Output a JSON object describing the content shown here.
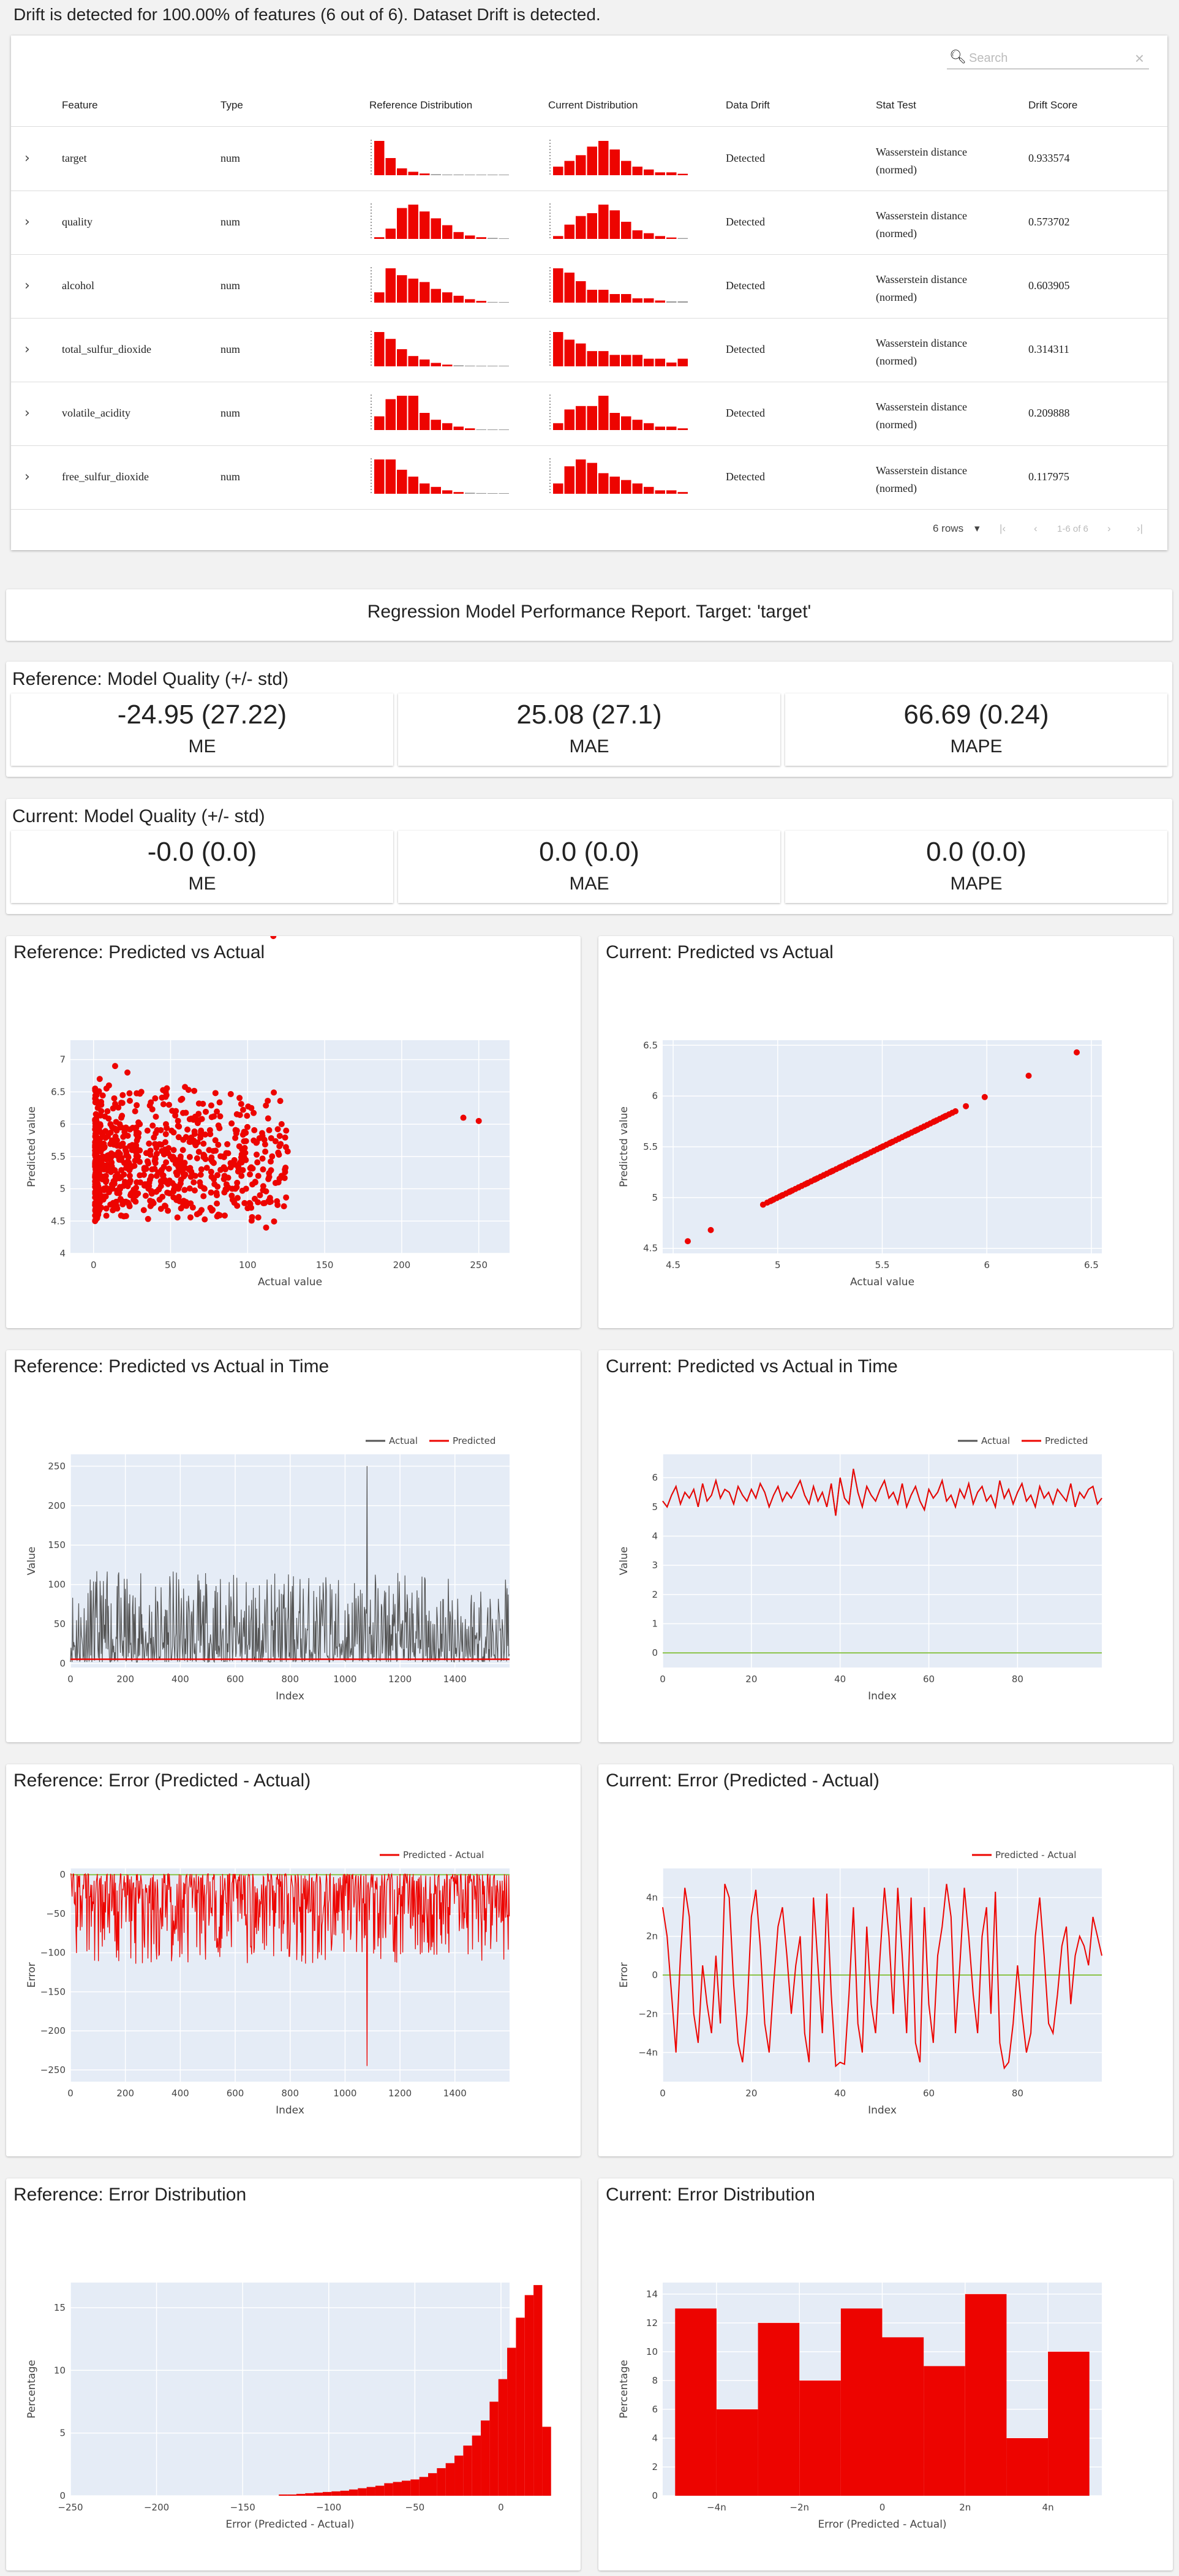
{
  "drift": {
    "header": "Drift is detected for 100.00% of features (6 out of 6). Dataset Drift is detected.",
    "search_placeholder": "Search",
    "columns": [
      "Feature",
      "Type",
      "Reference Distribution",
      "Current Distribution",
      "Data Drift",
      "Stat Test",
      "Drift Score"
    ],
    "rows": [
      {
        "feature": "target",
        "type": "num",
        "drift": "Detected",
        "stat_test": "Wasserstein distance (normed)",
        "score": "0.933574"
      },
      {
        "feature": "quality",
        "type": "num",
        "drift": "Detected",
        "stat_test": "Wasserstein distance (normed)",
        "score": "0.573702"
      },
      {
        "feature": "alcohol",
        "type": "num",
        "drift": "Detected",
        "stat_test": "Wasserstein distance (normed)",
        "score": "0.603905"
      },
      {
        "feature": "total_sulfur_dioxide",
        "type": "num",
        "drift": "Detected",
        "stat_test": "Wasserstein distance (normed)",
        "score": "0.314311"
      },
      {
        "feature": "volatile_acidity",
        "type": "num",
        "drift": "Detected",
        "stat_test": "Wasserstein distance (normed)",
        "score": "0.209888"
      },
      {
        "feature": "free_sulfur_dioxide",
        "type": "num",
        "drift": "Detected",
        "stat_test": "Wasserstein distance (normed)",
        "score": "0.117975"
      }
    ],
    "footer": {
      "rows_select": "6 rows",
      "range": "1-6 of 6"
    },
    "ref_hist": [
      [
        10,
        5,
        2,
        1,
        0.5,
        0.3,
        0.2,
        0.2,
        0.1,
        0.1,
        0.1,
        0.1
      ],
      [
        0.5,
        3,
        9,
        10,
        8,
        6,
        4,
        2,
        1,
        0.5,
        0.3,
        0.1
      ],
      [
        3,
        10,
        8,
        7,
        6,
        4,
        3,
        2,
        1,
        0.5,
        0.2,
        0.1
      ],
      [
        10,
        8,
        5,
        3,
        2,
        1,
        0.5,
        0.3,
        0.2,
        0.1,
        0.1,
        0.1
      ],
      [
        4,
        9,
        10,
        10,
        5,
        3,
        2,
        1,
        0.5,
        0.2,
        0.1,
        0.1
      ],
      [
        10,
        10,
        7,
        5,
        3,
        2,
        1,
        0.5,
        0.3,
        0.2,
        0.1,
        0.1
      ]
    ],
    "cur_hist": [
      [
        3,
        5,
        7,
        10,
        12,
        9,
        5,
        3,
        2,
        1,
        1,
        0.5
      ],
      [
        1,
        5,
        8,
        9,
        12,
        10,
        6,
        3,
        2,
        1,
        0.5,
        0.3
      ],
      [
        8,
        7,
        5,
        3,
        3,
        2,
        2,
        1,
        1,
        0.5,
        0.3,
        0.3
      ],
      [
        9,
        7,
        6,
        4,
        4,
        3,
        3,
        3,
        2,
        2,
        1,
        2
      ],
      [
        2,
        6,
        7,
        7,
        10,
        5,
        4,
        3,
        2,
        1,
        1,
        0.5
      ],
      [
        3,
        8,
        10,
        9,
        6,
        5,
        4,
        3,
        2,
        1,
        1,
        0.5
      ]
    ]
  },
  "colors": {
    "red": "#ed0400",
    "accent_dark": "#555555",
    "green": "#8bc34a",
    "plot_bg": "#e5ecf6"
  },
  "perf": {
    "title": "Regression Model Performance Report. Target: 'target'",
    "reference": {
      "title": "Reference: Model Quality (+/- std)",
      "metrics": [
        {
          "value": "-24.95 (27.22)",
          "name": "ME"
        },
        {
          "value": "25.08 (27.1)",
          "name": "MAE"
        },
        {
          "value": "66.69 (0.24)",
          "name": "MAPE"
        }
      ]
    },
    "current": {
      "title": "Current: Model Quality (+/- std)",
      "metrics": [
        {
          "value": "-0.0 (0.0)",
          "name": "ME"
        },
        {
          "value": "0.0 (0.0)",
          "name": "MAE"
        },
        {
          "value": "0.0 (0.0)",
          "name": "MAPE"
        }
      ]
    }
  },
  "plots": {
    "ref_pva": {
      "title": "Reference: Predicted vs Actual",
      "xlabel": "Actual value",
      "ylabel": "Predicted value"
    },
    "cur_pva": {
      "title": "Current: Predicted vs Actual",
      "xlabel": "Actual value",
      "ylabel": "Predicted value"
    },
    "ref_time": {
      "title": "Reference: Predicted vs Actual in Time",
      "xlabel": "Index",
      "ylabel": "Value",
      "legend": [
        "Actual",
        "Predicted"
      ]
    },
    "cur_time": {
      "title": "Current: Predicted vs Actual in Time",
      "xlabel": "Index",
      "ylabel": "Value",
      "legend": [
        "Actual",
        "Predicted"
      ]
    },
    "ref_err": {
      "title": "Reference: Error (Predicted - Actual)",
      "xlabel": "Index",
      "ylabel": "Error",
      "legend": [
        "Predicted - Actual"
      ]
    },
    "cur_err": {
      "title": "Current: Error (Predicted - Actual)",
      "xlabel": "Index",
      "ylabel": "Error",
      "legend": [
        "Predicted - Actual"
      ]
    },
    "ref_dist": {
      "title": "Reference: Error Distribution",
      "xlabel": "Error (Predicted - Actual)",
      "ylabel": "Percentage"
    },
    "cur_dist": {
      "title": "Current: Error Distribution",
      "xlabel": "Error (Predicted - Actual)",
      "ylabel": "Percentage"
    }
  },
  "chart_data": [
    {
      "id": "ref_pva",
      "type": "scatter",
      "xlim": [
        -15,
        270
      ],
      "ylim": [
        4,
        7.3
      ],
      "xticks": [
        0,
        50,
        100,
        150,
        200,
        250
      ],
      "yticks": [
        4,
        4.5,
        5,
        5.5,
        6,
        6.5,
        7
      ],
      "x": [
        2,
        5,
        8,
        10,
        12,
        15,
        18,
        20,
        22,
        25,
        28,
        30,
        33,
        36,
        40,
        45,
        50,
        55,
        60,
        65,
        70,
        75,
        80,
        85,
        90,
        95,
        100,
        105,
        110,
        115,
        120,
        125,
        3,
        6,
        9,
        14,
        19,
        24,
        31,
        38,
        47,
        58,
        66,
        78,
        92,
        108,
        122,
        240,
        250,
        4,
        7,
        11,
        16,
        21,
        27,
        35,
        44,
        52,
        62,
        72,
        84,
        96,
        112,
        1,
        13,
        17,
        23,
        29,
        41,
        49,
        57,
        69,
        81,
        99,
        117
      ],
      "y": [
        5.8,
        6.3,
        5.2,
        6.6,
        5.0,
        5.9,
        6.1,
        5.4,
        6.8,
        5.6,
        5.1,
        6.0,
        5.3,
        5.7,
        6.4,
        5.2,
        5.5,
        5.0,
        5.8,
        5.1,
        5.3,
        5.6,
        4.9,
        5.2,
        5.0,
        5.4,
        4.7,
        5.1,
        5.3,
        4.8,
        5.1,
        5.9,
        4.6,
        5.5,
        6.2,
        6.9,
        5.7,
        4.9,
        6.5,
        5.3,
        6.0,
        5.6,
        5.2,
        5.4,
        5.0,
        4.9,
        5.2,
        6.1,
        6.05,
        6.7,
        5.3,
        6.0,
        5.5,
        4.8,
        6.2,
        5.9,
        5.1,
        5.6,
        5.3,
        5.0,
        5.5,
        5.2,
        4.4,
        4.5,
        5.7,
        6.0,
        5.4,
        5.8,
        5.2,
        6.3,
        5.4,
        5.1,
        4.6,
        5.0
      ]
    },
    {
      "id": "cur_pva",
      "type": "scatter",
      "xlim": [
        4.45,
        6.55
      ],
      "ylim": [
        4.45,
        6.55
      ],
      "xticks": [
        4.5,
        5,
        5.5,
        6,
        6.5
      ],
      "yticks": [
        4.5,
        5,
        5.5,
        6,
        6.5
      ],
      "x": [
        4.57,
        4.68,
        4.93,
        4.97,
        5.02,
        5.06,
        5.1,
        5.14,
        5.18,
        5.22,
        5.26,
        5.3,
        5.34,
        5.38,
        5.42,
        5.46,
        5.5,
        5.54,
        5.58,
        5.62,
        5.66,
        5.7,
        5.75,
        5.8,
        5.85,
        5.9,
        5.99,
        6.2,
        6.43
      ],
      "y": [
        4.57,
        4.68,
        4.93,
        4.97,
        5.02,
        5.06,
        5.1,
        5.14,
        5.18,
        5.22,
        5.26,
        5.3,
        5.34,
        5.38,
        5.42,
        5.46,
        5.5,
        5.54,
        5.58,
        5.62,
        5.66,
        5.7,
        5.75,
        5.8,
        5.85,
        5.9,
        5.99,
        6.2,
        6.43
      ]
    },
    {
      "id": "ref_time",
      "type": "line",
      "xlim": [
        0,
        1599
      ],
      "ylim": [
        -5,
        265
      ],
      "xticks": [
        0,
        200,
        400,
        600,
        800,
        1000,
        1200,
        1400
      ],
      "yticks": [
        0,
        50,
        100,
        150,
        200,
        250
      ],
      "series": [
        {
          "name": "Actual",
          "color": "#555555",
          "values": "generated"
        },
        {
          "name": "Predicted",
          "color": "#ed0400",
          "values": "flat ~5.5"
        }
      ],
      "spike": {
        "x": 1080,
        "y": 250
      }
    },
    {
      "id": "cur_time",
      "type": "line",
      "xlim": [
        0,
        99
      ],
      "ylim": [
        -0.5,
        6.8
      ],
      "xticks": [
        0,
        20,
        40,
        60,
        80
      ],
      "yticks": [
        0,
        1,
        2,
        3,
        4,
        5,
        6
      ],
      "series": [
        {
          "name": "Actual",
          "values": [
            5.2,
            5.0,
            5.4,
            5.7,
            5.1,
            5.5,
            5.3,
            5.6,
            5.0,
            5.8,
            5.2,
            5.4,
            5.9,
            5.3,
            5.6,
            5.5,
            5.1,
            5.7,
            5.4,
            5.2,
            5.6,
            5.3,
            5.8,
            5.5,
            5.0,
            5.4,
            5.7,
            5.2,
            5.5,
            5.3,
            5.6,
            5.9,
            5.4,
            5.1,
            5.7,
            5.2,
            5.5,
            5.0,
            5.8,
            4.7,
            6.0,
            5.3,
            5.1,
            6.3,
            5.5,
            5.0,
            5.7,
            5.4,
            5.2,
            5.6,
            5.9,
            5.3,
            5.5,
            5.1,
            5.8,
            5.0,
            5.4,
            5.7,
            5.2,
            4.9,
            5.6,
            5.3,
            5.5,
            5.9,
            5.2,
            5.4,
            5.0,
            5.6,
            5.3,
            5.8,
            5.1,
            5.5,
            5.7,
            5.2,
            5.4,
            5.0,
            5.9,
            5.3,
            5.6,
            5.1,
            5.5,
            5.8,
            5.2,
            5.4,
            5.0,
            5.7,
            5.3,
            5.5,
            5.1,
            5.6,
            5.4,
            5.2,
            5.8,
            5.0,
            5.5,
            5.3,
            5.6,
            5.7,
            5.1,
            5.3
          ]
        },
        {
          "name": "Predicted",
          "values": "same as Actual"
        }
      ]
    },
    {
      "id": "ref_err",
      "type": "line",
      "xlim": [
        0,
        1599
      ],
      "ylim": [
        -265,
        8
      ],
      "xticks": [
        0,
        200,
        400,
        600,
        800,
        1000,
        1200,
        1400
      ],
      "yticks": [
        0,
        -50,
        -100,
        -150,
        -200,
        -250
      ],
      "series": [
        {
          "name": "Predicted - Actual",
          "values": "generated"
        }
      ],
      "spike": {
        "x": 1080,
        "y": -245
      }
    },
    {
      "id": "cur_err",
      "type": "line",
      "xlim": [
        0,
        99
      ],
      "ylim": [
        -5.5,
        5.5
      ],
      "xticks": [
        0,
        20,
        40,
        60,
        80
      ],
      "yticks": [
        -4,
        -2,
        0,
        2,
        4
      ],
      "ytick_labels": [
        "−4n",
        "−2n",
        "0",
        "2n",
        "4n"
      ],
      "series": [
        {
          "name": "Predicted - Actual",
          "values": [
            3.5,
            2.0,
            -1.0,
            -4.0,
            1.0,
            4.5,
            3.0,
            -2.0,
            -3.5,
            0.5,
            -1.5,
            -3.0,
            1.0,
            -2.5,
            4.7,
            4.0,
            -0.5,
            -3.5,
            -4.5,
            -2.0,
            3.0,
            4.4,
            1.5,
            -2.5,
            -4.0,
            -0.5,
            2.5,
            3.5,
            1.0,
            -2.0,
            0.5,
            2.0,
            -3.0,
            -4.5,
            4.0,
            0.5,
            -3.0,
            4.2,
            -1.0,
            -4.7,
            -4.5,
            -4.6,
            -1.0,
            3.5,
            -2.5,
            -4.0,
            2.5,
            -1.5,
            -3.0,
            1.0,
            4.5,
            2.0,
            -2.0,
            4.5,
            1.0,
            -3.0,
            4.0,
            -3.5,
            -4.5,
            3.5,
            -1.5,
            -3.5,
            1.0,
            2.5,
            4.7,
            3.0,
            -3.0,
            0.5,
            4.5,
            2.0,
            -1.0,
            -3.0,
            2.0,
            3.5,
            -2.0,
            4.3,
            -3.5,
            -4.8,
            -4.5,
            -2.5,
            0.5,
            -2.0,
            -4.0,
            -3.0,
            2.0,
            4.0,
            1.0,
            -2.5,
            -3.0,
            -1.0,
            1.5,
            2.5,
            -1.5,
            1.0,
            2.0,
            1.5,
            0.5,
            3.0,
            2.0,
            1.0
          ]
        }
      ]
    },
    {
      "id": "ref_dist",
      "type": "bar",
      "xlim": [
        -250,
        5
      ],
      "ylim": [
        0,
        17
      ],
      "xticks": [
        -250,
        -200,
        -150,
        -100,
        -50,
        0
      ],
      "yticks": [
        0,
        5,
        10,
        15
      ],
      "bins_start": -129,
      "bin_width": 5.1,
      "values": [
        0.1,
        0.1,
        0.15,
        0.2,
        0.25,
        0.3,
        0.35,
        0.4,
        0.5,
        0.6,
        0.7,
        0.8,
        1.0,
        1.1,
        1.2,
        1.3,
        1.5,
        1.8,
        2.2,
        2.6,
        3.2,
        4.0,
        4.8,
        6.0,
        7.5,
        9.3,
        11.8,
        14.2,
        16.0,
        16.8,
        5.5
      ]
    },
    {
      "id": "cur_dist",
      "type": "bar",
      "xlim": [
        -5.3,
        5.3
      ],
      "ylim": [
        0,
        14.8
      ],
      "xticks": [
        -4,
        -2,
        0,
        2,
        4
      ],
      "xtick_labels": [
        "−4n",
        "−2n",
        "0",
        "2n",
        "4n"
      ],
      "yticks": [
        0,
        2,
        4,
        6,
        8,
        10,
        12,
        14
      ],
      "bins_start": -5,
      "bin_width": 1,
      "values": [
        13,
        6,
        12,
        8,
        13,
        11,
        9,
        14,
        4,
        10
      ]
    }
  ]
}
